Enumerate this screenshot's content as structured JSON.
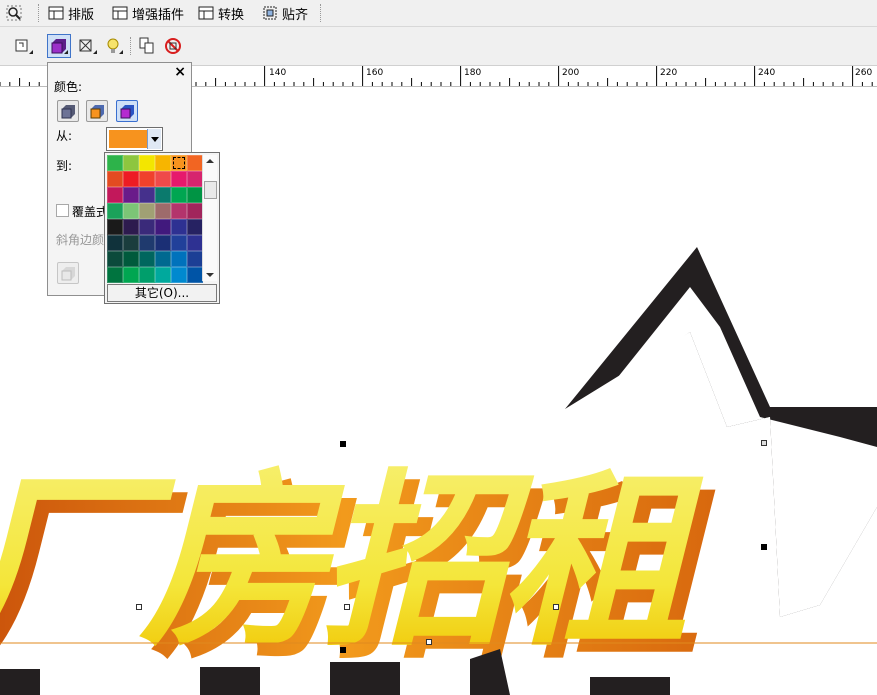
{
  "toolbar": {
    "items": [
      {
        "label": "排版",
        "icon": "layout-icon"
      },
      {
        "label": "增强插件",
        "icon": "plugin-icon"
      },
      {
        "label": "转换",
        "icon": "convert-icon"
      },
      {
        "label": "贴齐",
        "icon": "snap-icon"
      }
    ]
  },
  "ruler": {
    "ticks": [
      "140",
      "160",
      "180",
      "200",
      "220",
      "240",
      "260"
    ]
  },
  "panel": {
    "color_label": "颜色:",
    "from_label": "从:",
    "to_label": "到:",
    "overlay_label": "覆盖式",
    "bevel_color_label": "斜角边颜",
    "close_symbol": "×",
    "from_color": "#f7931e"
  },
  "palette": {
    "other_label": "其它(O)...",
    "colors": [
      "#2db34a",
      "#8dc63f",
      "#f3e600",
      "#f7b500",
      "#f7931e",
      "#f26522",
      "#e34b21",
      "#ed1c24",
      "#f0412c",
      "#ef4a4a",
      "#e6196c",
      "#d6246e",
      "#c2185b",
      "#6a1b8a",
      "#45308c",
      "#0b7a6d",
      "#00a651",
      "#009444",
      "#1ba25a",
      "#7cc576",
      "#a0a074",
      "#9e6b6b",
      "#b3346c",
      "#a1255c",
      "#1a1a1a",
      "#2d1b4e",
      "#3a2a7a",
      "#41197d",
      "#2e3192",
      "#262262",
      "#10323b",
      "#1a3d3d",
      "#1f3a6e",
      "#1b2f75",
      "#21409a",
      "#2e3192",
      "#0b4a3b",
      "#005a3c",
      "#00665e",
      "#006990",
      "#0072bc",
      "#1c3f95",
      "#00743f",
      "#00a651",
      "#009e6b",
      "#00a99d",
      "#0089cf",
      "#0054a6"
    ]
  },
  "canvas": {
    "headline": "厂房招租",
    "colors": {
      "text_top": "#f7ef6e",
      "text_bottom": "#f0c400",
      "extrude": "#e07a10",
      "star": "#231f20"
    }
  }
}
